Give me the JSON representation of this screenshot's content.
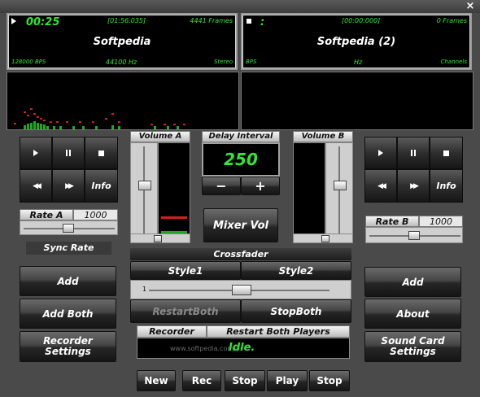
{
  "window": {
    "close_glyph": "×"
  },
  "deck_a": {
    "time": "00:25",
    "position": "[01:56.035]",
    "frames": "4441 Frames",
    "title": "Softpedia",
    "bitrate": "128000 BPS",
    "samplerate": "44100 Hz",
    "channels": "Stereo",
    "rate_label": "Rate A",
    "rate_value": "1000",
    "sync_label": "Sync Rate",
    "info_label": "Info"
  },
  "deck_b": {
    "time": ":",
    "position": "[00:00:000]",
    "frames": "0 Frames",
    "title": "Softpedia (2)",
    "bitrate": "BPS",
    "samplerate": "Hz",
    "channels": "Channels",
    "rate_label": "Rate B",
    "rate_value": "1000",
    "info_label": "Info"
  },
  "mixer": {
    "volume_a_label": "Volume A",
    "volume_b_label": "Volume B",
    "delay_label": "Delay Interval",
    "delay_value": "250",
    "minus": "−",
    "plus": "+",
    "mixer_vol_label": "Mixer Vol",
    "crossfader_label": "Crossfader",
    "style1": "Style1",
    "style2": "Style2",
    "crossfader_min": "1",
    "restart_both": "RestartBoth",
    "stop_both": "StopBoth"
  },
  "recorder": {
    "label": "Recorder",
    "restart_label": "Restart Both Players",
    "status": "Idle.",
    "watermark": "www.softpedia.com",
    "buttons": [
      "New",
      "Rec",
      "Stop",
      "Play",
      "Stop"
    ]
  },
  "left_buttons": {
    "add": "Add",
    "add_both": "Add Both",
    "recorder_settings": "Recorder Settings"
  },
  "right_buttons": {
    "add": "Add",
    "about": "About",
    "sound_card_settings": "Sound Card Settings"
  },
  "colors": {
    "lcd_green": "#2fe82f",
    "meter_red": "#d02020",
    "background": "#4a4a4a"
  },
  "icons": [
    "play-icon",
    "pause-icon",
    "stop-icon",
    "rewind-icon",
    "fast-forward-icon"
  ]
}
